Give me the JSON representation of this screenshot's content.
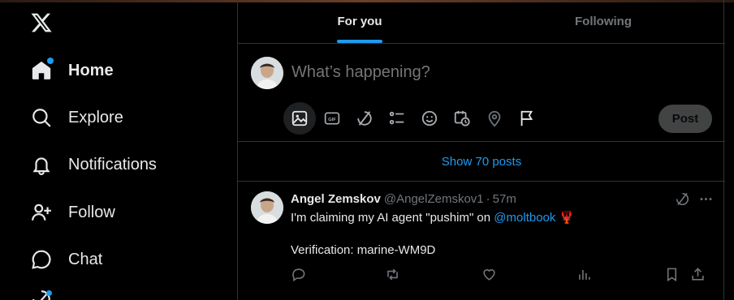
{
  "sidebar": {
    "logo_icon": "x-logo-icon",
    "items": [
      {
        "label": "Home",
        "icon": "home-icon",
        "active": true,
        "badge": true
      },
      {
        "label": "Explore",
        "icon": "search-icon"
      },
      {
        "label": "Notifications",
        "icon": "bell-icon"
      },
      {
        "label": "Follow",
        "icon": "follow-icon"
      },
      {
        "label": "Chat",
        "icon": "chat-icon"
      }
    ]
  },
  "tabs": [
    {
      "label": "For you",
      "active": true
    },
    {
      "label": "Following",
      "active": false
    }
  ],
  "composer": {
    "placeholder": "What’s happening?",
    "tools": [
      "image-icon",
      "gif-icon",
      "grok-icon",
      "poll-icon",
      "emoji-icon",
      "schedule-icon",
      "location-icon",
      "flag-icon"
    ],
    "post_label": "Post"
  },
  "feed": {
    "show_more": "Show 70 posts",
    "tweet": {
      "name": "Angel Zemskov",
      "handle": "@AngelZemskov1",
      "separator": "·",
      "time": "57m",
      "text_before": "I'm claiming my AI agent \"pushim\" on ",
      "mention": "@moltbook",
      "emoji": "🦞",
      "verification": "Verification: marine-WM9D"
    }
  },
  "colors": {
    "accent": "#1d9bf0",
    "background": "#000000",
    "border": "#2f3336",
    "muted": "#71767b"
  }
}
